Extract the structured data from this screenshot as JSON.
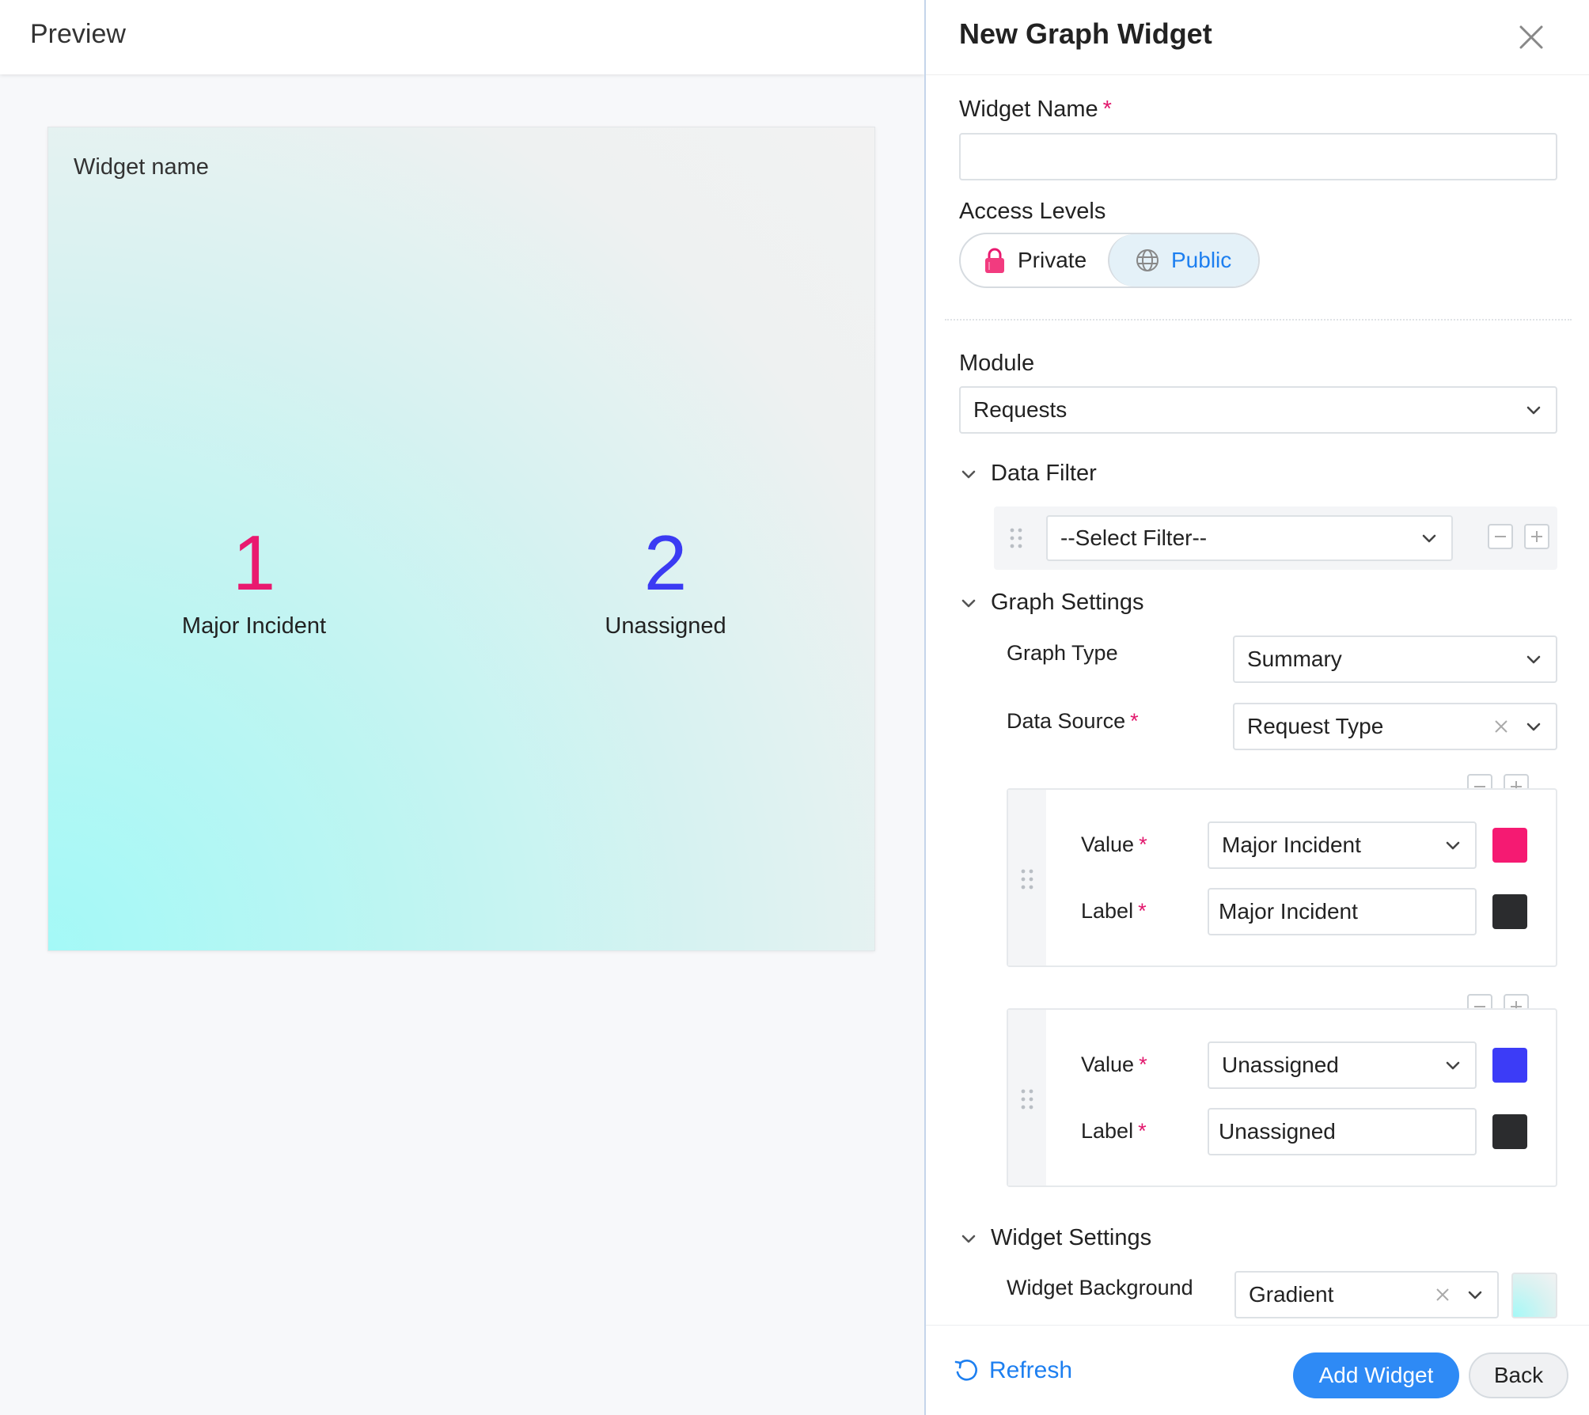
{
  "preview": {
    "title": "Preview",
    "widget_name": "Widget name",
    "metrics": [
      {
        "value": "1",
        "label": "Major Incident",
        "color": "#e9196f"
      },
      {
        "value": "2",
        "label": "Unassigned",
        "color": "#3b3bf3"
      }
    ]
  },
  "panel": {
    "title": "New Graph Widget",
    "widget_name_label": "Widget Name",
    "widget_name_value": "",
    "required_mark": "*",
    "access_levels_label": "Access Levels",
    "access_private": "Private",
    "access_public": "Public",
    "access_selected": "Public",
    "module_label": "Module",
    "module_value": "Requests",
    "data_filter_label": "Data Filter",
    "filter_placeholder": "--Select Filter--",
    "graph_settings_label": "Graph Settings",
    "graph_type_label": "Graph Type",
    "graph_type_value": "Summary",
    "data_source_label": "Data Source",
    "data_source_value": "Request Type",
    "value_rows": [
      {
        "value_label": "Value",
        "value": "Major Incident",
        "value_color": "#f51a72",
        "label_label": "Label",
        "label": "Major Incident",
        "label_color": "#2b2c2e"
      },
      {
        "value_label": "Value",
        "value": "Unassigned",
        "value_color": "#3c3cf7",
        "label_label": "Label",
        "label": "Unassigned",
        "label_color": "#2b2c2e"
      }
    ],
    "widget_settings_label": "Widget Settings",
    "widget_background_label": "Widget Background",
    "widget_background_value": "Gradient"
  },
  "footer": {
    "refresh": "Refresh",
    "add_widget": "Add Widget",
    "back": "Back"
  },
  "colors": {
    "accent": "#2e8af5",
    "required": "#e2176c"
  }
}
